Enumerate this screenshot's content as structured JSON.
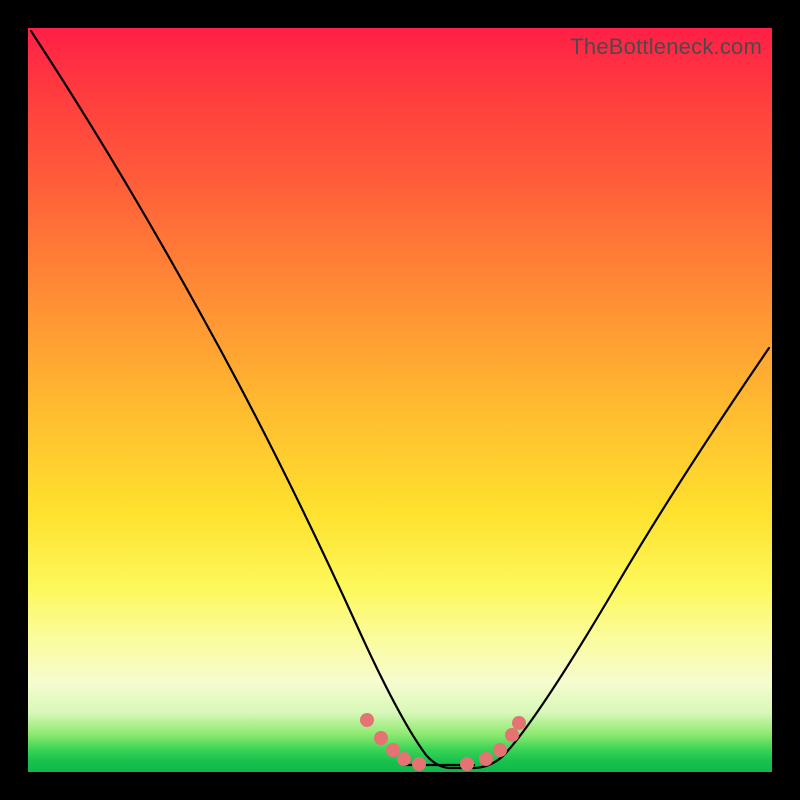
{
  "watermark": "TheBottleneck.com",
  "chart_data": {
    "type": "line",
    "title": "",
    "xlabel": "",
    "ylabel": "",
    "xlim": [
      0,
      1
    ],
    "ylim": [
      0,
      1
    ],
    "series": [
      {
        "name": "curve",
        "x": [
          0.0,
          0.05,
          0.1,
          0.15,
          0.2,
          0.25,
          0.3,
          0.35,
          0.4,
          0.45,
          0.48,
          0.5,
          0.52,
          0.55,
          0.58,
          0.6,
          0.63,
          0.66,
          0.7,
          0.75,
          0.8,
          0.85,
          0.9,
          0.95,
          1.0
        ],
        "values": [
          1.0,
          0.9,
          0.79,
          0.68,
          0.57,
          0.46,
          0.35,
          0.25,
          0.16,
          0.08,
          0.04,
          0.02,
          0.01,
          0.005,
          0.005,
          0.005,
          0.01,
          0.02,
          0.05,
          0.11,
          0.19,
          0.28,
          0.37,
          0.46,
          0.55
        ]
      }
    ],
    "markers": [
      {
        "x": 0.455,
        "y": 0.065
      },
      {
        "x": 0.475,
        "y": 0.04
      },
      {
        "x": 0.49,
        "y": 0.025
      },
      {
        "x": 0.505,
        "y": 0.012
      },
      {
        "x": 0.525,
        "y": 0.006
      },
      {
        "x": 0.59,
        "y": 0.006
      },
      {
        "x": 0.615,
        "y": 0.012
      },
      {
        "x": 0.635,
        "y": 0.025
      },
      {
        "x": 0.65,
        "y": 0.045
      },
      {
        "x": 0.66,
        "y": 0.06
      }
    ],
    "trough_segment": {
      "x0": 0.505,
      "x1": 0.6,
      "y": 0.005
    },
    "annotations": []
  }
}
